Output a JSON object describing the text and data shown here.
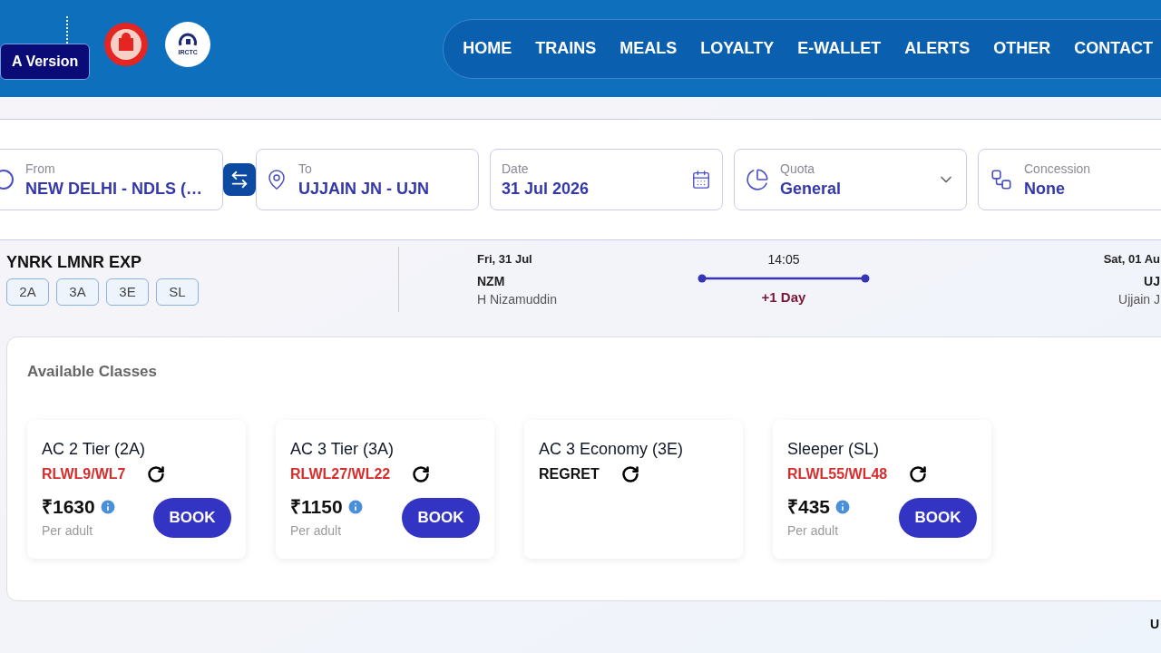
{
  "header": {
    "version_button": "A Version",
    "logo_text": "IRCTC",
    "nav": [
      {
        "label": "HOME"
      },
      {
        "label": "TRAINS"
      },
      {
        "label": "MEALS"
      },
      {
        "label": "LOYALTY"
      },
      {
        "label": "E-WALLET"
      },
      {
        "label": "ALERTS"
      },
      {
        "label": "OTHER"
      },
      {
        "label": "CONTACT"
      }
    ]
  },
  "search": {
    "fields": [
      {
        "kind": "from",
        "label": "From",
        "value": "NEW DELHI - NDLS (…"
      },
      {
        "kind": "to",
        "label": "To",
        "value": "UJJAIN JN - UJN"
      },
      {
        "kind": "date",
        "label": "Date",
        "value": "31 Jul 2026"
      },
      {
        "kind": "quota",
        "label": "Quota",
        "value": "General"
      },
      {
        "kind": "concession",
        "label": "Concession",
        "value": "None"
      }
    ]
  },
  "train": {
    "name": "YNRK LMNR EXP",
    "classes": [
      "2A",
      "3A",
      "3E",
      "SL"
    ],
    "departure_date": "Fri, 31 Jul",
    "departure_code": "NZM",
    "departure_station": "H Nizamuddin",
    "duration": "14:05",
    "day_offset": "+1 Day",
    "arrival_date": "Sat, 01 Au",
    "arrival_code": "UJ",
    "arrival_station": "Ujjain J"
  },
  "available_classes": {
    "title": "Available Classes",
    "cards": [
      {
        "kind": "waitlist",
        "name": "AC 2 Tier (2A)",
        "status": "RLWL9/WL7",
        "price": "₹1630",
        "per": "Per adult",
        "button": "BOOK"
      },
      {
        "kind": "waitlist",
        "name": "AC 3 Tier (3A)",
        "status": "RLWL27/WL22",
        "price": "₹1150",
        "per": "Per adult",
        "button": "BOOK"
      },
      {
        "kind": "regret",
        "name": "AC 3 Economy (3E)",
        "status": "REGRET"
      },
      {
        "kind": "waitlist",
        "name": "Sleeper (SL)",
        "status": "RLWL55/WL48",
        "price": "₹435",
        "per": "Per adult",
        "button": "BOOK"
      }
    ]
  },
  "footer_text": "U"
}
